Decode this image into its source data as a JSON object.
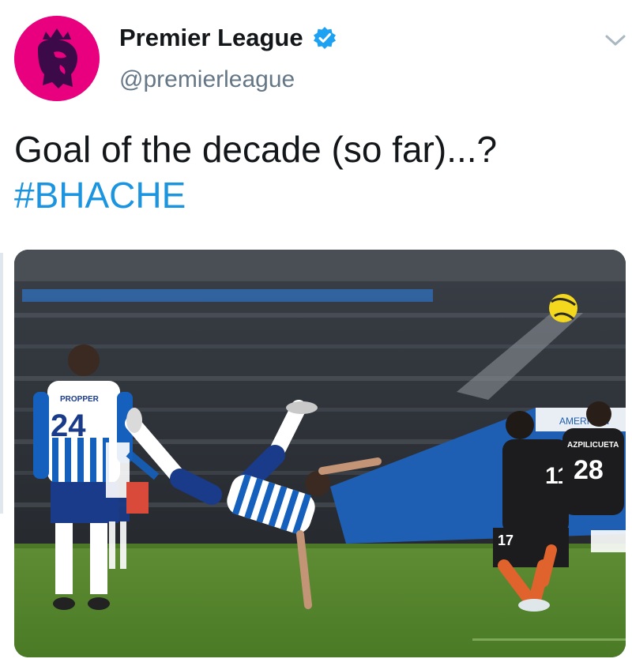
{
  "author": {
    "name": "Premier League",
    "handle": "@premierleague",
    "verified": true
  },
  "tweet": {
    "text": "Goal of the decade (so far)...?",
    "hashtag": "#BHACHE"
  },
  "media": {
    "players": [
      {
        "number": "24",
        "name": "PROPPER"
      },
      {
        "number": "28",
        "name": "AZPILICUETA"
      },
      {
        "number": "17",
        "name": ""
      },
      {
        "number": "11",
        "name": ""
      }
    ],
    "board_text": "AMERICAN"
  },
  "colors": {
    "brand": "#e9007f",
    "hashtag": "#1b95e0",
    "verified": "#1da1f2",
    "handle": "#657786"
  },
  "icons": {
    "avatar": "premier-league-lion-logo",
    "verified": "verified-badge-icon",
    "menu": "chevron-down-icon"
  }
}
